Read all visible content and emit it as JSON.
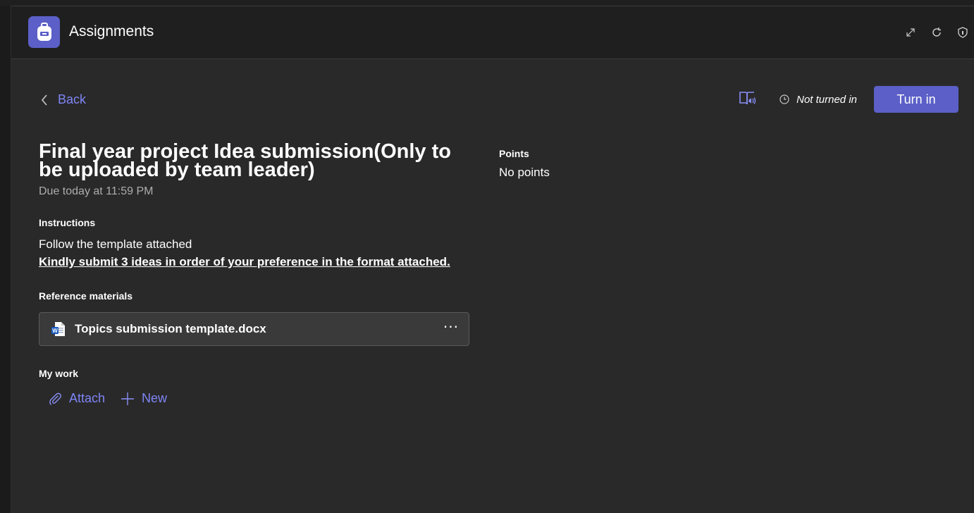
{
  "app": {
    "title": "Assignments",
    "logo_icon": "backpack-icon",
    "accent_color": "#5b5fc7",
    "link_color": "#7f85f5",
    "toolbar_icons": [
      "expand-icon",
      "refresh-icon",
      "shield-icon"
    ]
  },
  "nav": {
    "back_label": "Back"
  },
  "status": {
    "label": "Not turned in",
    "icon": "clock-icon"
  },
  "actions": {
    "turn_in_label": "Turn in",
    "reader_icon": "immersive-reader-icon"
  },
  "assignment": {
    "title": "Final year project Idea submission(Only to be uploaded by team leader)",
    "due": "Due today at 11:59 PM",
    "instructions_label": "Instructions",
    "instructions": [
      "Follow the template attached",
      "Kindly submit 3 ideas in order of your preference in the format attached."
    ],
    "reference_label": "Reference materials",
    "reference_files": [
      {
        "name": "Topics submission template.docx",
        "icon": "word-doc-icon"
      }
    ],
    "my_work_label": "My work",
    "my_work_actions": {
      "attach_label": "Attach",
      "new_label": "New"
    },
    "points_label": "Points",
    "points_value": "No points"
  }
}
